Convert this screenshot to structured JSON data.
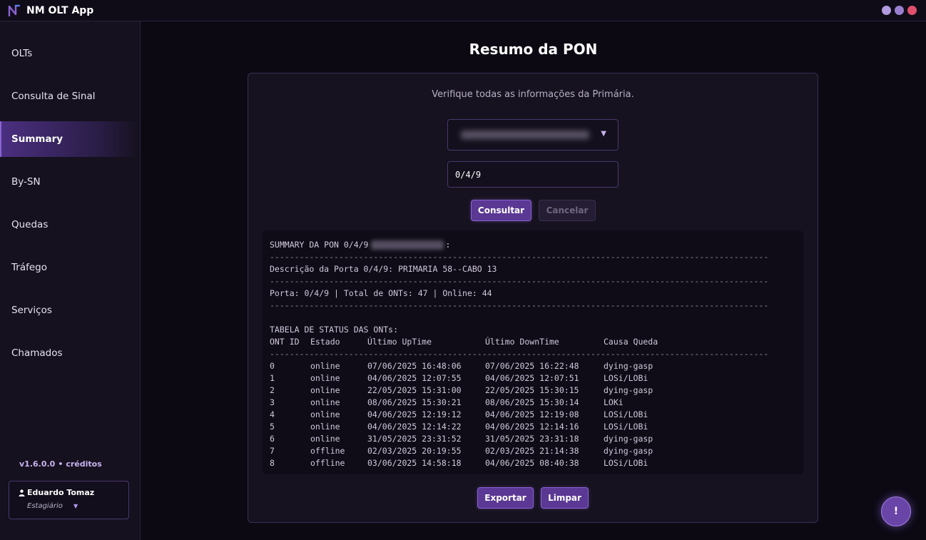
{
  "window": {
    "title": "NM OLT App",
    "controls": [
      {
        "name": "minimize",
        "color": "#b39be0"
      },
      {
        "name": "maximize",
        "color": "#9a7fd0"
      },
      {
        "name": "close",
        "color": "#e0506e"
      }
    ]
  },
  "sidebar": {
    "items": [
      {
        "label": "OLTs"
      },
      {
        "label": "Consulta de Sinal"
      },
      {
        "label": "Summary",
        "active": true
      },
      {
        "label": "By-SN"
      },
      {
        "label": "Quedas"
      },
      {
        "label": "Tráfego"
      },
      {
        "label": "Serviços"
      },
      {
        "label": "Chamados"
      }
    ],
    "version": "v1.6.0.0",
    "version_sep": "•",
    "credits": "créditos",
    "user": {
      "name": "Eduardo Tomaz",
      "role": "Estagiário"
    }
  },
  "main": {
    "title": "Resumo da PON",
    "subtitle": "Verifique todas as informações da Primária.",
    "port_value": "0/4/9",
    "consult_label": "Consultar",
    "cancel_label": "Cancelar",
    "export_label": "Exportar",
    "clear_label": "Limpar",
    "help_label": "!"
  },
  "output": {
    "header": "SUMMARY DA PON 0/4/9",
    "header_suffix": ":",
    "separator": "-----------------------------------------------------------------------------------------------------",
    "description": "Descrição da Porta 0/4/9: PRIMARIA 58--CABO 13",
    "stats": "Porta: 0/4/9 | Total de ONTs: 47 | Online: 44",
    "table_title": "TABELA DE STATUS DAS ONTs:",
    "columns": [
      "ONT ID",
      "Estado",
      "Último UpTime",
      "Último DownTime",
      "Causa Queda"
    ],
    "rows": [
      [
        "0",
        "online",
        "07/06/2025 16:48:06",
        "07/06/2025 16:22:48",
        "dying-gasp"
      ],
      [
        "1",
        "online",
        "04/06/2025 12:07:55",
        "04/06/2025 12:07:51",
        "LOSi/LOBi"
      ],
      [
        "2",
        "online",
        "22/05/2025 15:31:00",
        "22/05/2025 15:30:15",
        "dying-gasp"
      ],
      [
        "3",
        "online",
        "08/06/2025 15:30:21",
        "08/06/2025 15:30:14",
        "LOKi"
      ],
      [
        "4",
        "online",
        "04/06/2025 12:19:12",
        "04/06/2025 12:19:08",
        "LOSi/LOBi"
      ],
      [
        "5",
        "online",
        "04/06/2025 12:14:22",
        "04/06/2025 12:14:16",
        "LOSi/LOBi"
      ],
      [
        "6",
        "online",
        "31/05/2025 23:31:52",
        "31/05/2025 23:31:18",
        "dying-gasp"
      ],
      [
        "7",
        "offline",
        "02/03/2025 20:19:55",
        "02/03/2025 21:14:38",
        "dying-gasp"
      ],
      [
        "8",
        "offline",
        "03/06/2025 14:58:18",
        "04/06/2025 08:40:38",
        "LOSi/LOBi"
      ]
    ]
  }
}
